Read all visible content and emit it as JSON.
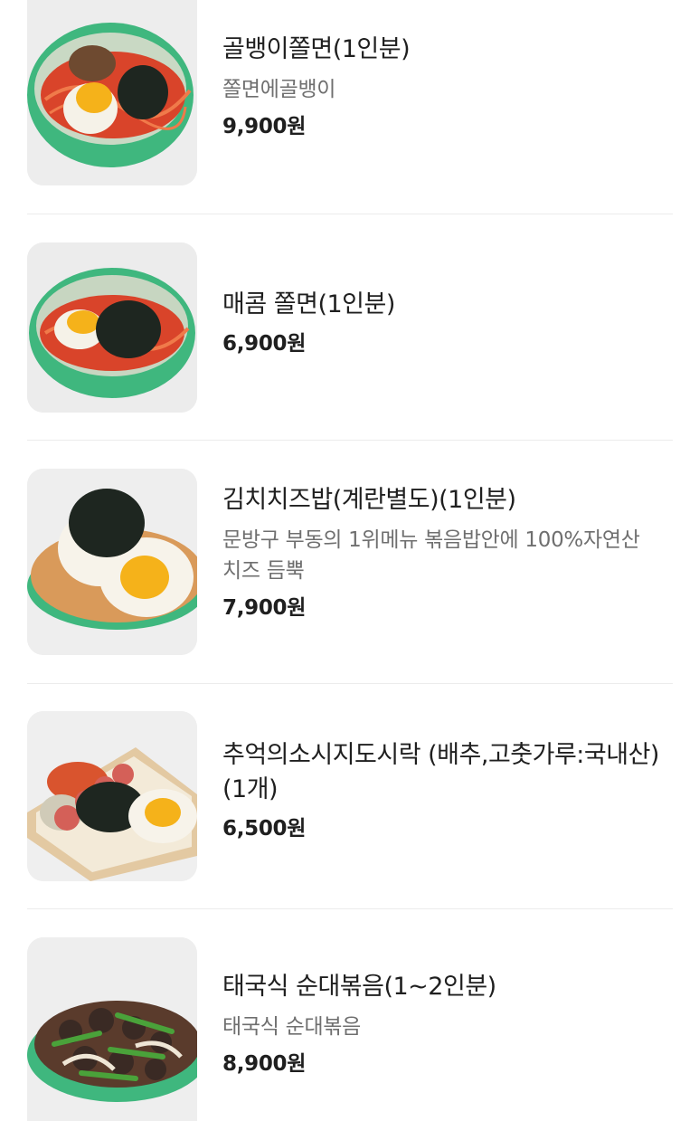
{
  "items": [
    {
      "name": "골뱅이쫄면(1인분)",
      "description": "쫄면에골뱅이",
      "price": "9,900원",
      "image": "bowl-noodles-golbaengi-photo"
    },
    {
      "name": "매콤 쫄면(1인분)",
      "description": "",
      "price": "6,900원",
      "image": "bowl-spicy-noodles-photo"
    },
    {
      "name": "김치치즈밥(계란별도)(1인분)",
      "description": "문방구 부동의 1위메뉴 볶음밥안에 100%자연산 치즈 듬뿍",
      "price": "7,900원",
      "image": "kimchi-cheese-rice-photo"
    },
    {
      "name": "추억의소시지도시락 (배추,고춧가루:국내산)(1개)",
      "description": "",
      "price": "6,500원",
      "image": "sausage-lunchbox-photo"
    },
    {
      "name": "태국식 순대볶음(1~2인분)",
      "description": "태국식 순대볶음",
      "price": "8,900원",
      "image": "thai-sundae-stirfry-photo"
    }
  ],
  "colors": {
    "bowl_green": "#3fb77e",
    "noodle_red": "#d9442a",
    "egg_yolk": "#f5b21a",
    "text_primary": "#1f1f1f",
    "text_secondary": "#6f6f6f"
  }
}
